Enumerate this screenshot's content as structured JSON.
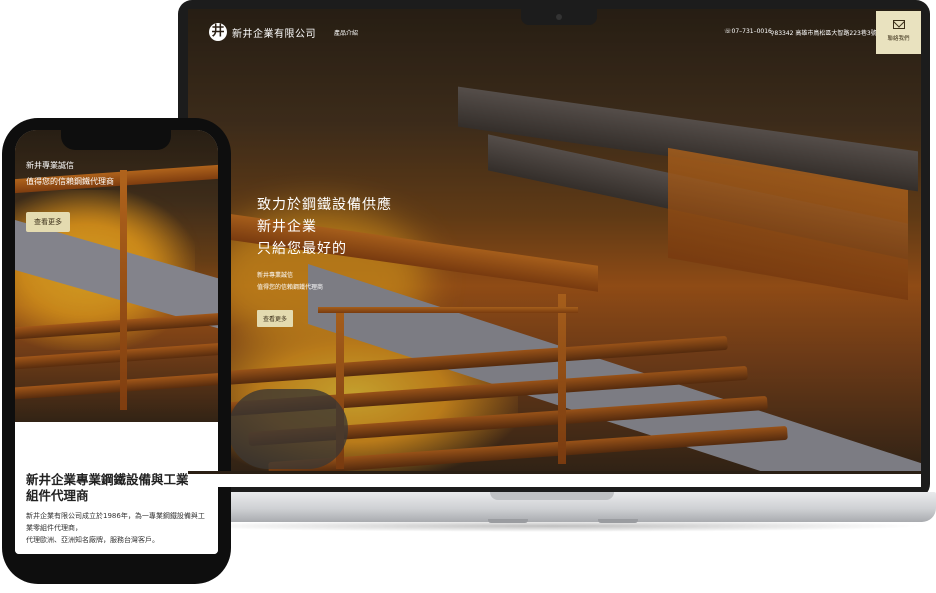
{
  "desktop": {
    "logo_mark": "井",
    "logo_text": "新井企業有限公司",
    "nav_product": "產品介紹",
    "phone": "07–731–0016",
    "address": "83342 高雄市鳥松區大智路223巷3號",
    "contact_label": "聯絡我們",
    "hero_line1": "致力於鋼鐵設備供應",
    "hero_line2": "新井企業",
    "hero_line3": "只給您最好的",
    "sub_line1": "新井專業誠信",
    "sub_line2": "值得您的信賴鋼鐵代理商",
    "more_button": "查看更多"
  },
  "mobile": {
    "sub_line1": "新井專業誠信",
    "sub_line2": "值得您的信賴鋼鐵代理商",
    "more_button": "查看更多",
    "title": "新井企業專業鋼鐵設備與工業零組件代理商",
    "desc_line1": "新井企業有限公司成立於1986年，為一專業鋼鐵設備與工業零組件代理商，",
    "desc_line2": "代理歐洲、亞洲知名廠牌，服務台灣客戶。"
  },
  "colors": {
    "accent_button": "#e4dbb0",
    "dark_text": "#3a2e18",
    "device_frame": "#1c1c1c"
  },
  "icons": {
    "contact": "envelope-icon",
    "phone": "phone-icon",
    "address": "location-pin-icon"
  }
}
